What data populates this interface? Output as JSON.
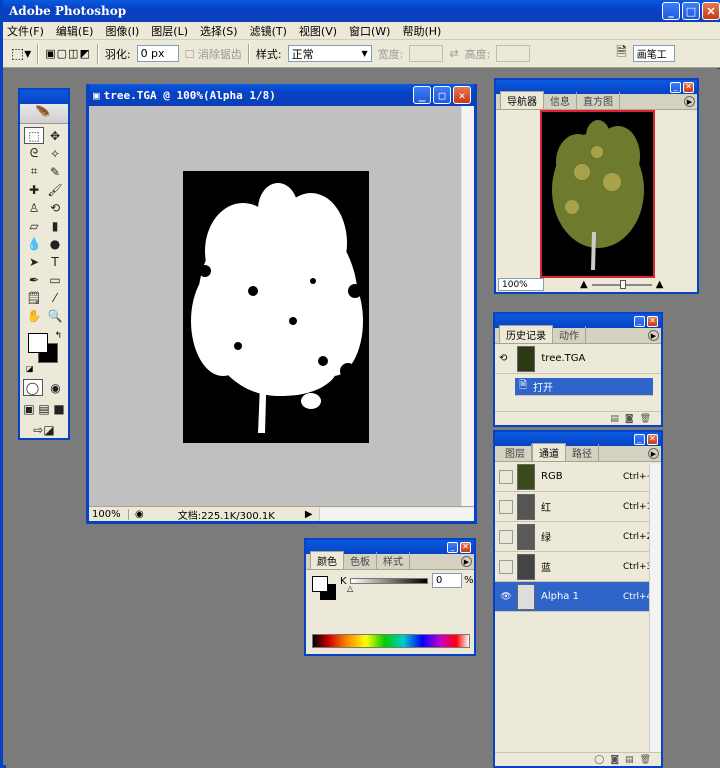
{
  "app": {
    "title": "Adobe Photoshop"
  },
  "menu": [
    "文件(F)",
    "编辑(E)",
    "图像(I)",
    "图层(L)",
    "选择(S)",
    "滤镜(T)",
    "视图(V)",
    "窗口(W)",
    "帮助(H)"
  ],
  "options": {
    "feather_label": "羽化:",
    "feather_value": "0 px",
    "antialias_label": "消除锯齿",
    "style_label": "样式:",
    "style_value": "正常",
    "width_label": "宽度:",
    "height_label": "高度:",
    "workspace_btn": "画笔工"
  },
  "document": {
    "title": "tree.TGA @ 100%(Alpha 1/8)",
    "zoom": "100%",
    "doc_size": "文档:225.1K/300.1K"
  },
  "navigator": {
    "tabs": [
      "导航器",
      "信息",
      "直方图"
    ],
    "zoom": "100%"
  },
  "history": {
    "tabs": [
      "历史记录",
      "动作"
    ],
    "snapshot": "tree.TGA",
    "steps": [
      "打开"
    ]
  },
  "channels": {
    "tabs": [
      "图层",
      "通道",
      "路径"
    ],
    "items": [
      {
        "name": "RGB",
        "key": "Ctrl+~"
      },
      {
        "name": "红",
        "key": "Ctrl+1"
      },
      {
        "name": "绿",
        "key": "Ctrl+2"
      },
      {
        "name": "蓝",
        "key": "Ctrl+3"
      },
      {
        "name": "Alpha 1",
        "key": "Ctrl+4"
      }
    ]
  },
  "color": {
    "tabs": [
      "颜色",
      "色板",
      "样式"
    ],
    "k_label": "K",
    "k_value": "0",
    "unit": "%"
  },
  "colors": {
    "title_blue": "#0842c4",
    "panel_bg": "#ece9d8",
    "select_blue": "#2f64c8"
  }
}
